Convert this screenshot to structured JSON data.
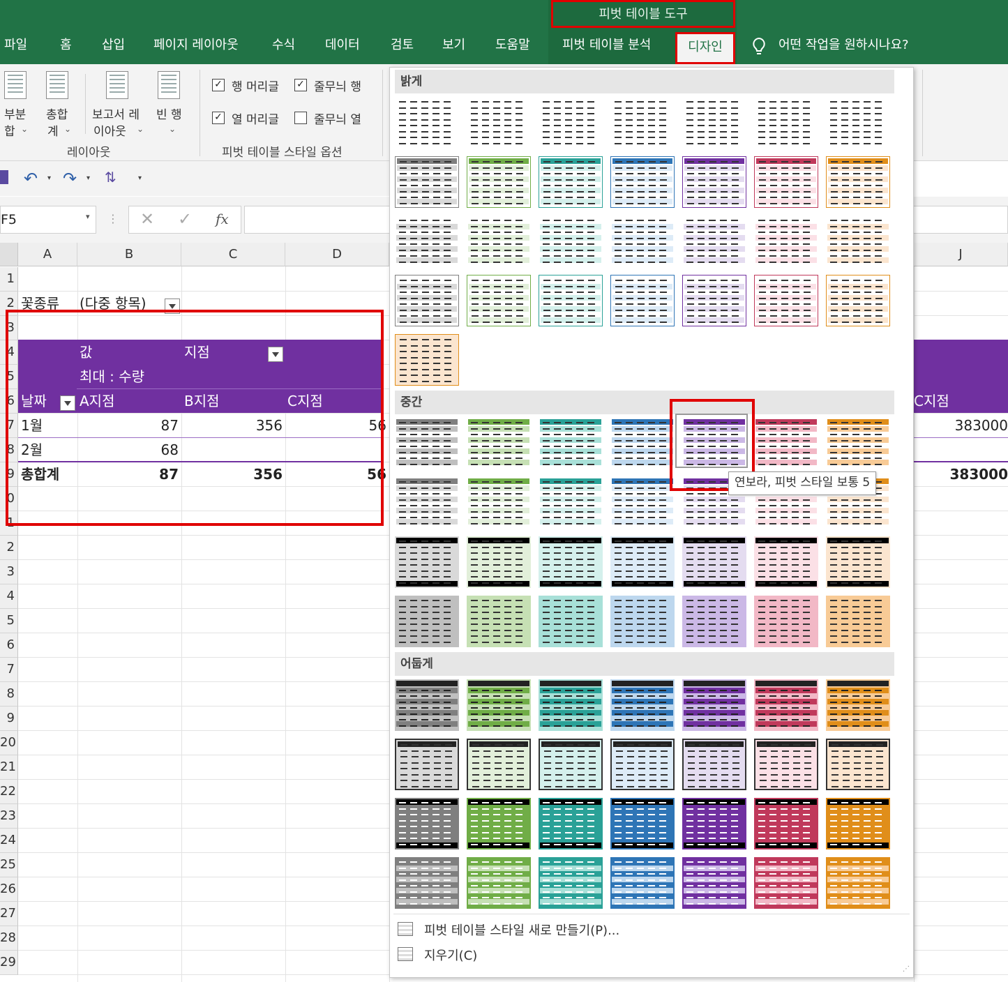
{
  "ribbon": {
    "contextual_group": "피벗 테이블 도구",
    "tabs": [
      "파일",
      "홈",
      "삽입",
      "페이지 레이아웃",
      "수식",
      "데이터",
      "검토",
      "보기",
      "도움말",
      "피벗 테이블 분석",
      "디자인"
    ],
    "tell_me": "어떤 작업을 원하시나요?",
    "layout_group": {
      "label": "레이아웃",
      "subtotal": [
        "부분",
        "합"
      ],
      "grandtotal": [
        "총합",
        "계"
      ],
      "report_layout": [
        "보고서 레",
        "이아웃"
      ],
      "blank_rows": "빈 행"
    },
    "style_options_group": {
      "label": "피벗 테이블 스타일 옵션",
      "row_headers": "행 머리글",
      "banded_rows": "줄무늬 행",
      "col_headers": "열 머리글",
      "banded_cols": "줄무늬 열"
    }
  },
  "formula_bar": {
    "name_box": "F5",
    "fx": "fx"
  },
  "grid": {
    "columns": [
      "A",
      "B",
      "C",
      "D",
      "J"
    ],
    "rows": [
      "1",
      "2",
      "3",
      "4",
      "5",
      "6",
      "7",
      "8",
      "9",
      "0",
      "1",
      "2",
      "3",
      "4",
      "5",
      "6",
      "7",
      "8",
      "9",
      "20",
      "21",
      "22",
      "23",
      "24",
      "25",
      "26",
      "27",
      "28",
      "29"
    ],
    "filter_label": "꽃종류",
    "filter_value": "(다중 항목)",
    "values_label": "값",
    "col_field": "지점",
    "measure": "최대 : 수량",
    "row_field": "날짜",
    "branch_a": "A지점",
    "branch_b": "B지점",
    "branch_c": "C지점",
    "r7": {
      "label": "1월",
      "a": "87",
      "b": "356",
      "c": "56",
      "j": "383000"
    },
    "r8": {
      "label": "2월",
      "a": "68"
    },
    "r9": {
      "label": "총합계",
      "a": "87",
      "b": "356",
      "c": "56",
      "j": "383000"
    },
    "j_header": "C지점"
  },
  "gallery": {
    "sections": [
      "밝게",
      "중간",
      "어둡게"
    ],
    "tooltip": "연보라, 피벗 스타일 보통 5",
    "new_style": "피벗 테이블 스타일 새로 만들기(P)...",
    "clear": "지우기(C)",
    "palette": [
      "#7f7f7f",
      "#70ad47",
      "#2aa197",
      "#2e75b6",
      "#7030a0",
      "#c0395b",
      "#e08e1a"
    ],
    "palette_light": [
      "#d9d9d9",
      "#e2efda",
      "#d4f0ec",
      "#ddebf7",
      "#e4dcf0",
      "#fbe0e6",
      "#fbe5cf"
    ],
    "palette_mid": [
      "#bfbfbf",
      "#c6e0b4",
      "#a8e0d8",
      "#bdd7ee",
      "#cbb8e6",
      "#f2b8c6",
      "#f8cb96"
    ]
  }
}
